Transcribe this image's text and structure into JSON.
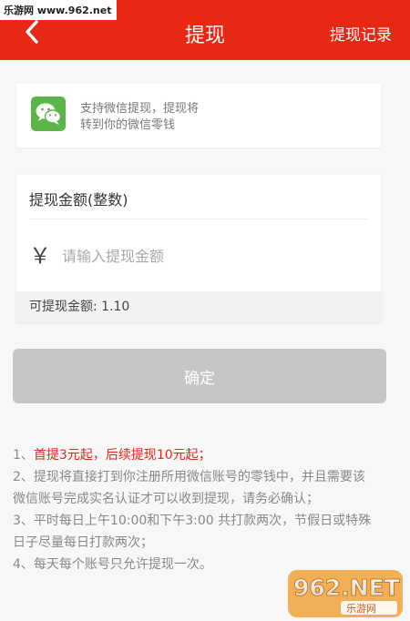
{
  "watermark_top": "乐游网 www.962.net",
  "header": {
    "back_icon": "chevron-left-icon",
    "title": "提现",
    "right_link": "提现记录"
  },
  "wechat": {
    "icon": "wechat-icon",
    "line1": "支持微信提现，提现将",
    "line2": "转到你的微信零钱"
  },
  "amount": {
    "label": "提现金额(整数)",
    "currency_symbol": "￥",
    "placeholder": "请输入提现金额",
    "available": "可提现金额: 1.10"
  },
  "confirm_button": "确定",
  "notes": [
    {
      "prefix": "1、",
      "highlight": "首提3元起，后续提现10元起；",
      "text": ""
    },
    {
      "prefix": "2、",
      "highlight": "",
      "text": "提现将直接打到你注册所用微信账号的零钱中，并且需要该微信账号完成实名认证才可以收到提现，请务必确认；"
    },
    {
      "prefix": "3、",
      "highlight": "",
      "text": "平时每日上午10:00和下午3:00 共打款两次，节假日或特殊日子尽量每日打款两次；"
    },
    {
      "prefix": "4、",
      "highlight": "",
      "text": "每天每个账号只允许提现一次。"
    }
  ],
  "watermark_bottom": {
    "main": "962.NET",
    "sub": "乐游网"
  },
  "colors": {
    "header": "#e62814",
    "note_highlight": "#d62b1c",
    "button_disabled": "#c6c6c6",
    "wechat_green": "#5cb54a"
  }
}
